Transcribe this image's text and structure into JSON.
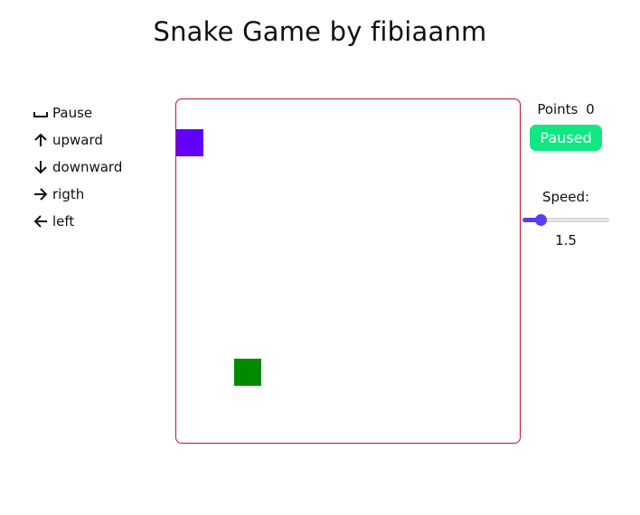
{
  "header": {
    "title": "Snake Game by fibiaanm"
  },
  "controls": [
    {
      "icon": "space-bar-icon",
      "label": "Pause"
    },
    {
      "icon": "arrow-up-icon",
      "label": "upward"
    },
    {
      "icon": "arrow-down-icon",
      "label": "downward"
    },
    {
      "icon": "arrow-right-icon",
      "label": "rigth"
    },
    {
      "icon": "arrow-left-icon",
      "label": "left"
    }
  ],
  "board": {
    "grid_size": 19,
    "border_color": "#c8102e",
    "snake": {
      "color": "#6200ff",
      "cells": [
        [
          0,
          1
        ]
      ]
    },
    "food": {
      "color": "#008a00",
      "cell": [
        3,
        10
      ]
    }
  },
  "status": {
    "points_label": "Points",
    "points_value": "0",
    "state_label": "Paused",
    "state_color": "#10e882"
  },
  "speed": {
    "label": "Speed:",
    "value": "1.5",
    "fraction": 0.1,
    "accent_color": "#5b3cf5"
  }
}
